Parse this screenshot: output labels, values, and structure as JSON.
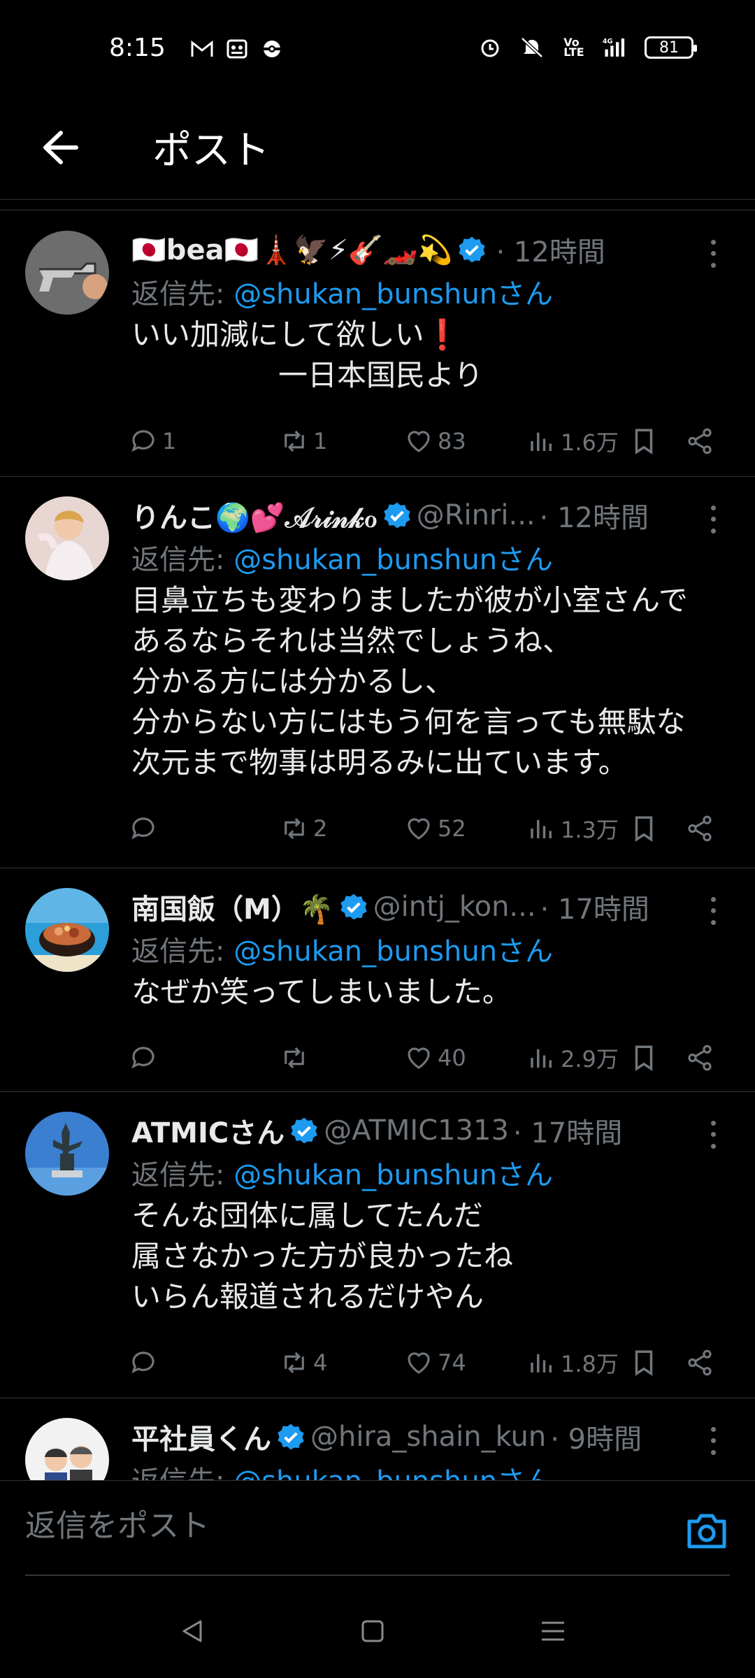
{
  "status": {
    "time": "8:15",
    "battery": "81"
  },
  "header": {
    "title": "ポスト"
  },
  "tweets": [
    {
      "display_name": "🇯🇵bea🇯🇵🗼🦅⚡🎸🏎️💫",
      "handle": "",
      "time": "· 12時間",
      "reply_prefix": "返信先: ",
      "reply_to": "@shukan_bunshunさん",
      "text": "いい加減にして欲しい❗\n　　　　　一日本国民より",
      "replies": "1",
      "retweets": "1",
      "likes": "83",
      "views": "1.6万"
    },
    {
      "display_name": "りんこ🌍💕𝒜𝓇𝒾𝓃𝓀ℴ",
      "handle": "@Rinri...",
      "time": "· 12時間",
      "reply_prefix": "返信先: ",
      "reply_to": "@shukan_bunshunさん",
      "text": "目鼻立ちも変わりましたが彼が小室さんで\nあるならそれは当然でしょうね、\n分かる方には分かるし、\n分からない方にはもう何を言っても無駄な\n次元まで物事は明るみに出ています。",
      "replies": "",
      "retweets": "2",
      "likes": "52",
      "views": "1.3万"
    },
    {
      "display_name": "南国飯（M）🌴",
      "handle": "@intj_kon...",
      "time": "· 17時間",
      "reply_prefix": "返信先: ",
      "reply_to": "@shukan_bunshunさん",
      "text": "なぜか笑ってしまいました。",
      "replies": "",
      "retweets": "",
      "likes": "40",
      "views": "2.9万"
    },
    {
      "display_name": "ATMICさん",
      "handle": "@ATMIC1313",
      "time": "· 17時間",
      "reply_prefix": "返信先: ",
      "reply_to": "@shukan_bunshunさん",
      "text": "そんな団体に属してたんだ\n属さなかった方が良かったね\nいらん報道されるだけやん",
      "replies": "",
      "retweets": "4",
      "likes": "74",
      "views": "1.8万"
    },
    {
      "display_name": "平社員くん",
      "handle": "@hira_shain_kun",
      "time": "· 9時間",
      "reply_prefix": "返信先: ",
      "reply_to": "@shukan_bunshunさん",
      "text": "",
      "replies": "",
      "retweets": "",
      "likes": "",
      "views": ""
    }
  ],
  "composer": {
    "placeholder": "返信をポスト"
  },
  "colors": {
    "accent": "#1d9bf0",
    "muted": "#71767b",
    "background": "#000000"
  }
}
